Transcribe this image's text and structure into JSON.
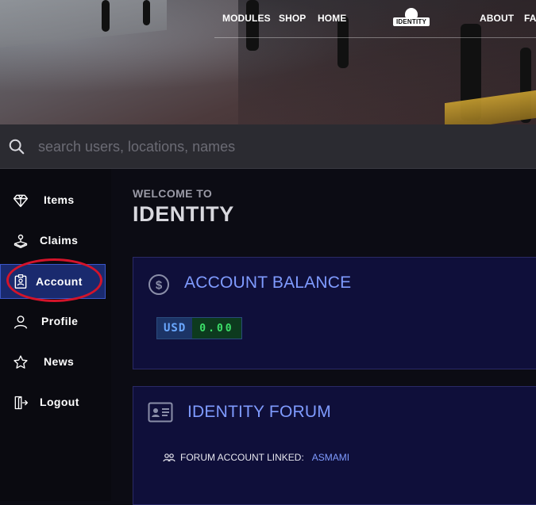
{
  "nav": {
    "links": [
      "MODULES",
      "SHOP",
      "HOME",
      "ABOUT",
      "FAQ"
    ],
    "logo_text": "IDENTITY"
  },
  "search": {
    "placeholder": "search users, locations, names"
  },
  "sidebar": {
    "items": [
      {
        "label": "Items",
        "icon": "diamond-icon"
      },
      {
        "label": "Claims",
        "icon": "claims-icon"
      },
      {
        "label": "Account",
        "icon": "id-badge-icon",
        "active": true
      },
      {
        "label": "Profile",
        "icon": "user-icon"
      },
      {
        "label": "News",
        "icon": "star-icon"
      },
      {
        "label": "Logout",
        "icon": "logout-icon"
      }
    ]
  },
  "welcome": {
    "subtitle": "WELCOME TO",
    "title": "IDENTITY"
  },
  "balance_card": {
    "title": "ACCOUNT BALANCE",
    "currency": "USD",
    "amount": "0.00"
  },
  "forum_card": {
    "title": "IDENTITY FORUM",
    "linked_label": "FORUM ACCOUNT LINKED:",
    "username": "ASMAMI"
  },
  "colors": {
    "accent": "#7f9bff",
    "active_bg": "#1a2a6e",
    "highlight_ring": "#d4142a",
    "money_green": "#3de06a"
  }
}
